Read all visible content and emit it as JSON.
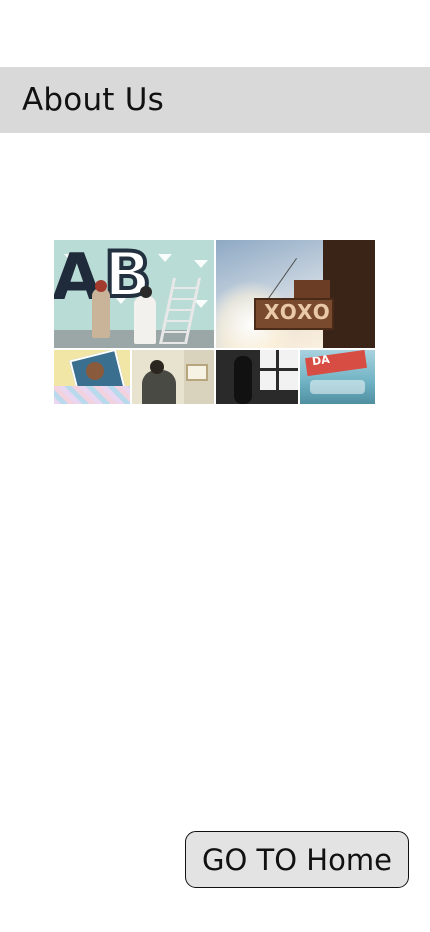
{
  "header": {
    "title": "About Us",
    "background_color": "#d9d9d9"
  },
  "collage": {
    "sign_text": "XOXO",
    "small_sign_text": "DA"
  },
  "actions": {
    "home_button_label": "GO TO Home"
  },
  "colors": {
    "page_background": "#ffffff",
    "button_background": "#e3e3e3",
    "button_border": "#111111"
  }
}
